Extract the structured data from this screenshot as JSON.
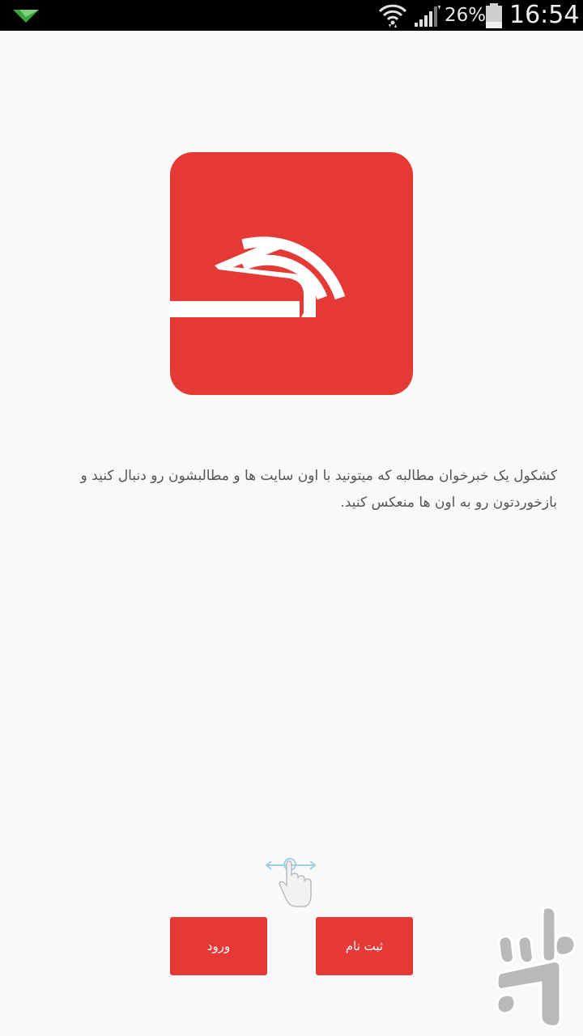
{
  "status_bar": {
    "battery_percent": "26%",
    "time": "16:54",
    "left_icon": "notification-plane-icon",
    "wifi_icon": "wifi-icon",
    "signal_icon": "cellular-signal-icon",
    "battery_icon": "battery-icon"
  },
  "logo": {
    "icon": "kashkool-logo-icon",
    "background_color": "#e53935"
  },
  "description": {
    "text": "کشکول یک خبرخوان مطالبه که میتونید با اون سایت ها و مطالبشون رو دنبال کنید و بازخوردتون رو به اون ها منعکس کنید."
  },
  "swipe_hint": {
    "icon": "swipe-hand-icon"
  },
  "buttons": {
    "login_label": "ورود",
    "register_label": "ثبت نام",
    "color": "#e53935"
  },
  "watermark": {
    "icon": "bazaar-watermark-icon"
  }
}
